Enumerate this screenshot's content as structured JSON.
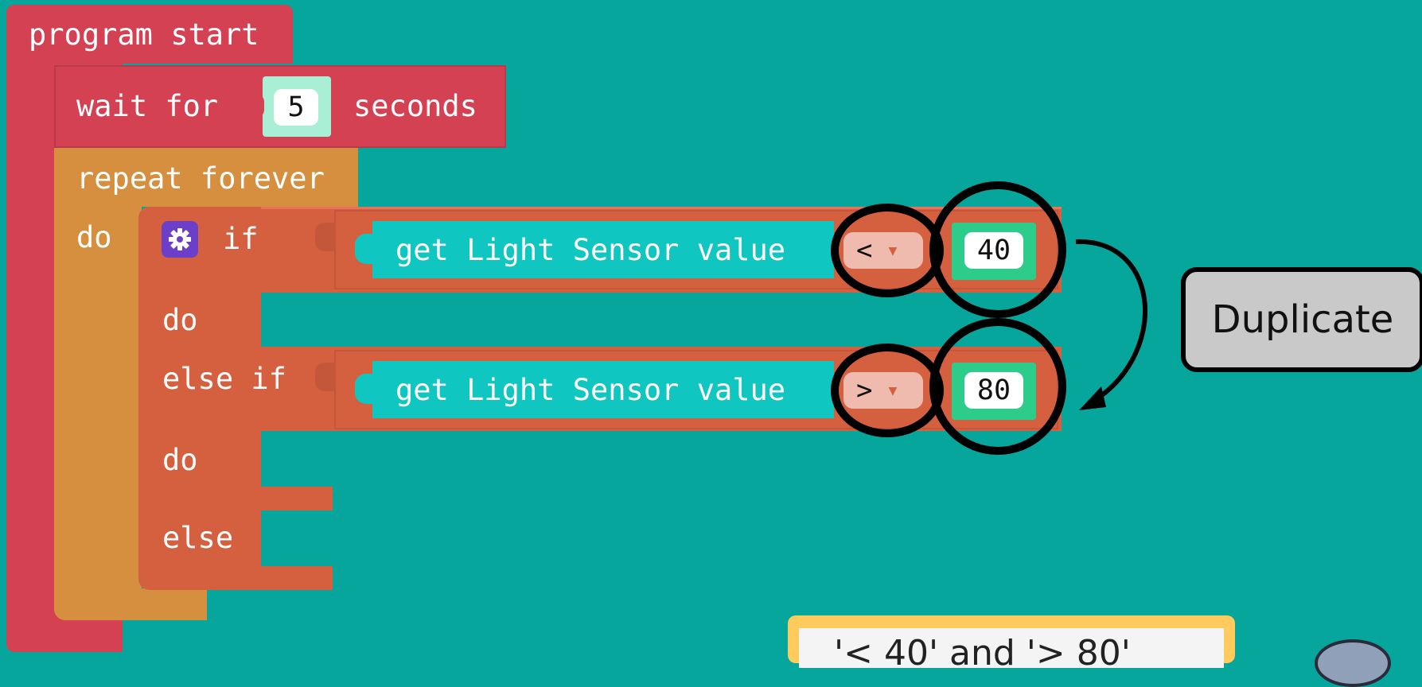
{
  "program_block": {
    "label": "program start"
  },
  "wait_block": {
    "prefix": "wait for",
    "value": "5",
    "suffix": "seconds"
  },
  "repeat_block": {
    "label": "repeat forever",
    "do_label": "do"
  },
  "if_block": {
    "if_label": "if",
    "do_label_1": "do",
    "else_if_label": "else if",
    "do_label_2": "do",
    "else_label": "else",
    "conditions": [
      {
        "sensor_label": "get Light Sensor value",
        "operator": "<",
        "value": "40"
      },
      {
        "sensor_label": "get Light Sensor value",
        "operator": ">",
        "value": "80"
      }
    ]
  },
  "annotation": {
    "duplicate_label": "Duplicate",
    "note_text": "'< 40' and '> 80'"
  },
  "colors": {
    "workspace": "#06A69C",
    "event_block": "#D34153",
    "loop_block": "#D58F3E",
    "logic_block": "#D5603F",
    "sensor_block": "#10C6C0",
    "number_block": "#2ECC8A",
    "gear_icon": "#6B3FC8"
  },
  "icons": {
    "settings": "gear-icon",
    "dropdown": "dropdown-arrow-icon",
    "arrow": "curved-arrow-icon"
  }
}
